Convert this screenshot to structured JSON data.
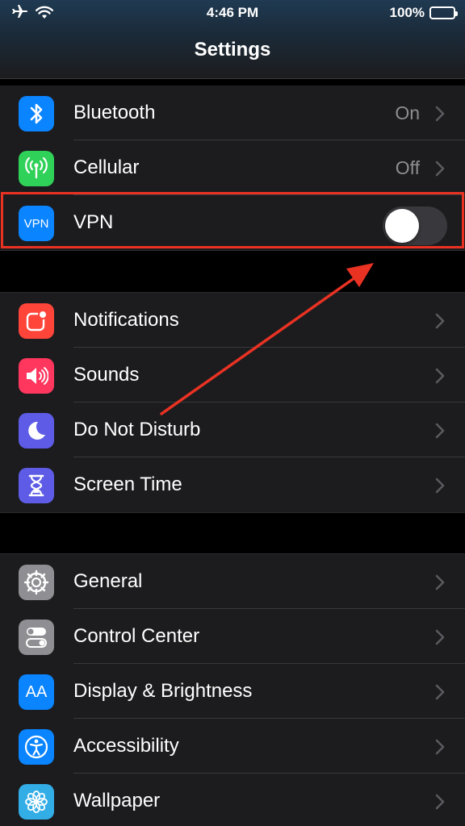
{
  "status_bar": {
    "time": "4:46 PM",
    "battery": "100%"
  },
  "nav": {
    "title": "Settings"
  },
  "group1": [
    {
      "label": "Bluetooth",
      "value": "On",
      "icon": "bluetooth-icon",
      "color": "#0a84ff"
    },
    {
      "label": "Cellular",
      "value": "Off",
      "icon": "cellular-antenna-icon",
      "color": "#30d158"
    },
    {
      "label": "VPN",
      "icon_text": "VPN",
      "icon": "vpn-icon",
      "color": "#0a84ff",
      "toggle_on": false
    }
  ],
  "group2": [
    {
      "label": "Notifications",
      "icon": "notifications-icon",
      "color": "#ff453a"
    },
    {
      "label": "Sounds",
      "icon": "speaker-icon",
      "color": "#ff375f"
    },
    {
      "label": "Do Not Disturb",
      "icon": "moon-icon",
      "color": "#5e5ce6"
    },
    {
      "label": "Screen Time",
      "icon": "hourglass-icon",
      "color": "#5e5ce6"
    }
  ],
  "group3": [
    {
      "label": "General",
      "icon": "gear-icon",
      "color": "#8e8e93"
    },
    {
      "label": "Control Center",
      "icon": "toggles-icon",
      "color": "#8e8e93"
    },
    {
      "label": "Display & Brightness",
      "icon_text": "AA",
      "icon": "text-size-icon",
      "color": "#0a84ff"
    },
    {
      "label": "Accessibility",
      "icon": "accessibility-icon",
      "color": "#0a84ff"
    },
    {
      "label": "Wallpaper",
      "icon": "flower-icon",
      "color": "#32ade6"
    }
  ],
  "annotation": {
    "highlight_color": "#ea3223"
  }
}
